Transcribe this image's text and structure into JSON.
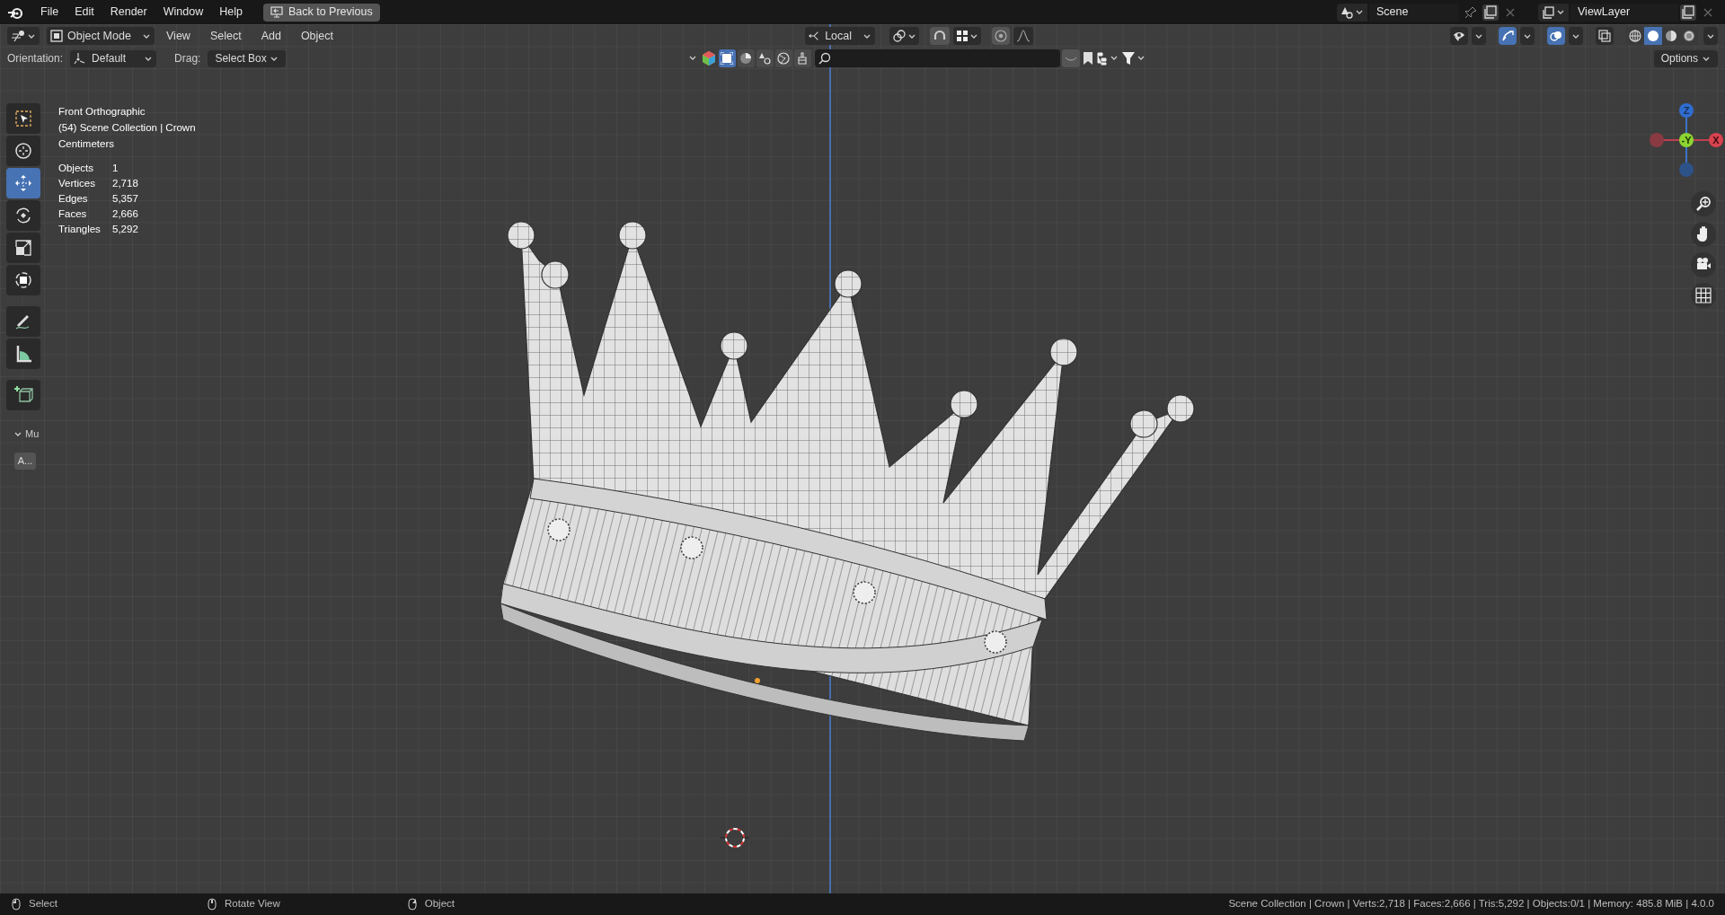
{
  "menu_bar": {
    "items": [
      "File",
      "Edit",
      "Render",
      "Window",
      "Help"
    ],
    "back_button": "Back to Previous"
  },
  "scene_selector": {
    "value": "Scene"
  },
  "view_layer_selector": {
    "value": "ViewLayer"
  },
  "header": {
    "mode": "Object Mode",
    "menus": [
      "View",
      "Select",
      "Add",
      "Object"
    ],
    "transform_orientation": "Local"
  },
  "header_toggles": [
    {
      "kind": "visibility",
      "on": false
    },
    {
      "kind": "gizmo",
      "on": true
    },
    {
      "kind": "overlay",
      "on": true
    },
    {
      "kind": "xray",
      "on": false
    }
  ],
  "shading_modes": [
    {
      "kind": "wireframe",
      "selected": false
    },
    {
      "kind": "solid",
      "selected": true
    },
    {
      "kind": "material",
      "selected": false
    },
    {
      "kind": "rendered",
      "selected": false
    }
  ],
  "filter_bar": {
    "buttons": [
      {
        "kind": "object",
        "selected": true
      },
      {
        "kind": "half",
        "selected": false
      },
      {
        "kind": "shapes",
        "selected": false
      },
      {
        "kind": "world",
        "selected": false
      },
      {
        "kind": "brush",
        "selected": false
      }
    ]
  },
  "tool_settings": {
    "orientation_label": "Orientation:",
    "orientation": "Default",
    "drag_label": "Drag:",
    "drag": "Select Box",
    "options": "Options"
  },
  "toolbar": {
    "tools": [
      {
        "kind": "select",
        "selected": false
      },
      {
        "kind": "cursor",
        "selected": false
      },
      {
        "kind": "move",
        "selected": true
      },
      {
        "kind": "rotate",
        "selected": false
      },
      {
        "kind": "scale",
        "selected": false
      },
      {
        "kind": "transform",
        "selected": false
      },
      {
        "kind": "annotate",
        "selected": false
      },
      {
        "kind": "measure",
        "selected": false
      },
      {
        "kind": "add_cube",
        "selected": false
      }
    ],
    "panel_title": "Mu",
    "panel_button": "A..."
  },
  "viewport_info": {
    "view": "Front Orthographic",
    "collection": "(54) Scene Collection | Crown",
    "units": "Centimeters",
    "stats": [
      {
        "label": "Objects",
        "value": "1"
      },
      {
        "label": "Vertices",
        "value": "2,718"
      },
      {
        "label": "Edges",
        "value": "5,357"
      },
      {
        "label": "Faces",
        "value": "2,666"
      },
      {
        "label": "Triangles",
        "value": "5,292"
      }
    ]
  },
  "axis_gizmo": {
    "axes": [
      {
        "kind": "z",
        "label": "Z"
      },
      {
        "kind": "y",
        "label": "-Y"
      },
      {
        "kind": "x",
        "label": "X"
      }
    ]
  },
  "status_bar": {
    "hints": [
      "Select",
      "Rotate View",
      "Object"
    ],
    "info": "Scene Collection | Crown | Verts:2,718 | Faces:2,666 | Tris:5,292 | Objects:0/1 | Memory: 485.8 MiB | 4.0.0"
  }
}
